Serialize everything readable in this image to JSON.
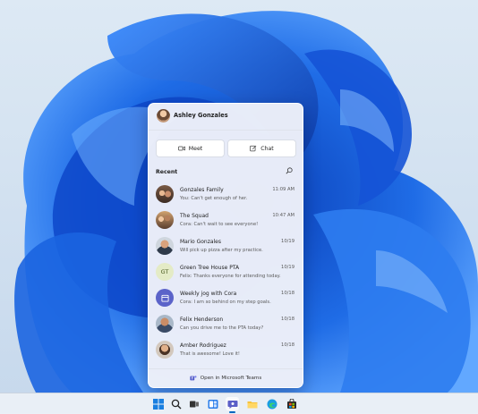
{
  "user": {
    "name": "Ashley Gonzales"
  },
  "actions": {
    "meet_label": "Meet",
    "chat_label": "Chat"
  },
  "recent": {
    "label": "Recent",
    "conversations": [
      {
        "name": "Gonzales Family",
        "preview": "You: Can't get enough of her.",
        "time": "11:09 AM",
        "avatar": "group-photo"
      },
      {
        "name": "The Squad",
        "preview": "Cora: Can't wait to see everyone!",
        "time": "10:47 AM",
        "avatar": "group-photo"
      },
      {
        "name": "Mario Gonzales",
        "preview": "Will pick up pizza after my practice.",
        "time": "10/19",
        "avatar": "person-photo"
      },
      {
        "name": "Green Tree House PTA",
        "preview": "Felix: Thanks everyone for attending today.",
        "time": "10/19",
        "avatar": "initials",
        "initials": "GT"
      },
      {
        "name": "Weekly jog with Cora",
        "preview": "Cora: I am so behind on my step goals.",
        "time": "10/18",
        "avatar": "calendar-icon"
      },
      {
        "name": "Felix Henderson",
        "preview": "Can you drive me to the PTA today?",
        "time": "10/18",
        "avatar": "person-photo"
      },
      {
        "name": "Amber Rodriguez",
        "preview": "That is awesome! Love it!",
        "time": "10/18",
        "avatar": "person-photo"
      }
    ]
  },
  "footer": {
    "open_teams_label": "Open in Microsoft Teams"
  },
  "taskbar": {
    "icons": [
      "start-icon",
      "search-icon",
      "task-view-icon",
      "widgets-icon",
      "chat-icon",
      "file-explorer-icon",
      "edge-icon",
      "store-icon"
    ],
    "active": "chat-icon"
  },
  "colors": {
    "accent": "#0067c0",
    "wallpaper_base": "#d3e2f0",
    "bloom_blue": "#1a5fd8"
  }
}
